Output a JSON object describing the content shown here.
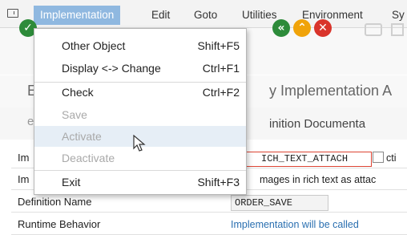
{
  "menubar": {
    "items": [
      "Implementation",
      "Edit",
      "Goto",
      "Utilities",
      "Environment",
      "Sy"
    ]
  },
  "title": {
    "left_char": "E",
    "text": "y Implementation A"
  },
  "tabs": {
    "left_glyph": "e",
    "definition": "inition Documenta"
  },
  "dropdown": {
    "items": [
      {
        "label": "Other Object",
        "shortcut": "Shift+F5",
        "enabled": true
      },
      {
        "label": "Display <-> Change",
        "shortcut": "Ctrl+F1",
        "enabled": true
      },
      {
        "label": "Check",
        "shortcut": "Ctrl+F2",
        "enabled": true
      },
      {
        "label": "Save",
        "shortcut": "",
        "enabled": false
      },
      {
        "label": "Activate",
        "shortcut": "",
        "enabled": false
      },
      {
        "label": "Deactivate",
        "shortcut": "",
        "enabled": false
      },
      {
        "label": "Exit",
        "shortcut": "Shift+F3",
        "enabled": true
      }
    ]
  },
  "form": {
    "impl_name": {
      "label": "Im",
      "value": "ICH_TEXT_ATTACH",
      "suffix": "cti"
    },
    "impl_short_text": {
      "label": "Im",
      "value": "mages in rich text as attac"
    },
    "definition_name": {
      "label": "Definition Name",
      "value": "ORDER_SAVE"
    },
    "runtime_behavior": {
      "label": "Runtime Behavior",
      "value": "Implementation will be called"
    }
  },
  "colors": {
    "menu_active_bg": "#8fb8e0",
    "green": "#2d8b3a",
    "orange": "#f0a30a",
    "red": "#d9342b",
    "link_blue": "#2a6fb0"
  }
}
